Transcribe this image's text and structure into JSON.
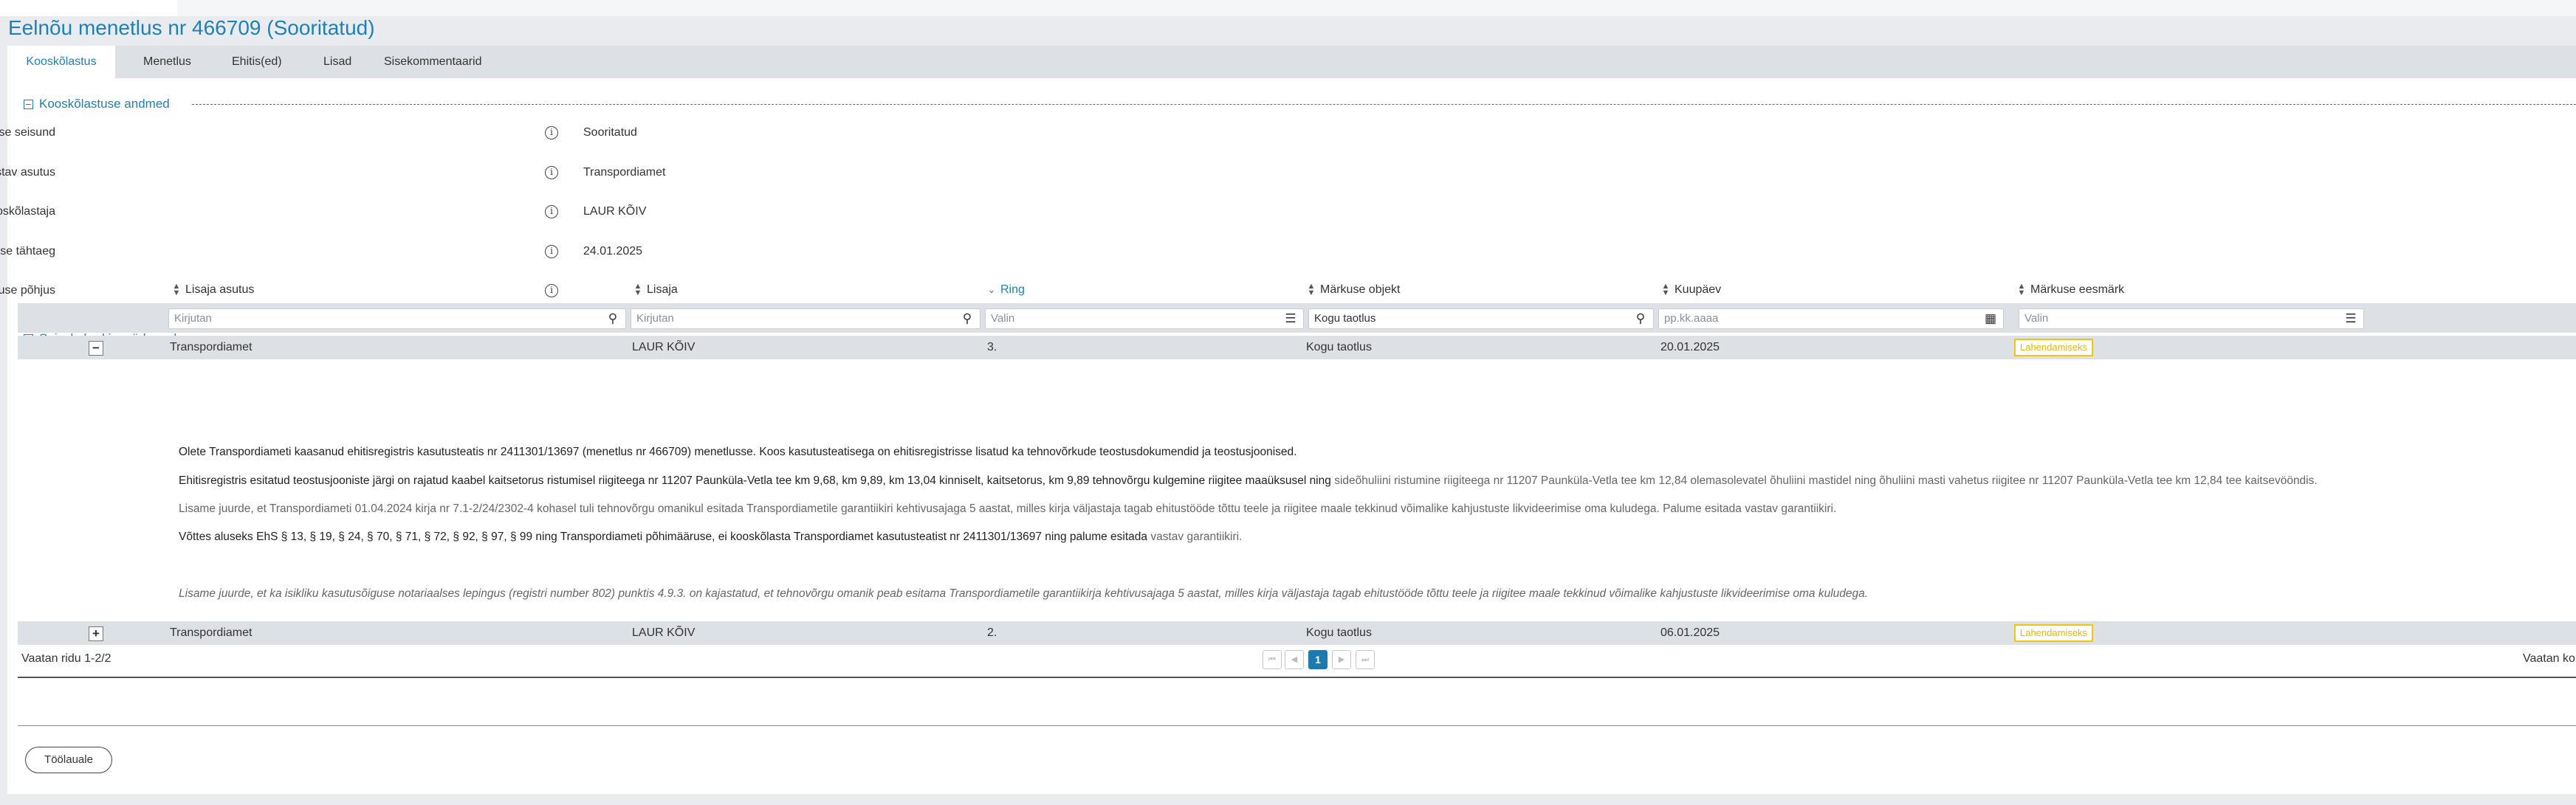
{
  "page_title": "Eelnõu menetlus nr 466709 (Sooritatud)",
  "tabs": [
    {
      "label": "Kooskõlastus",
      "active": true
    },
    {
      "label": "Menetlus"
    },
    {
      "label": "Ehitis(ed)"
    },
    {
      "label": "Lisad"
    },
    {
      "label": "Sisekommentaarid"
    }
  ],
  "section1": {
    "title": "Kooskõlastuse andmed",
    "fields": [
      {
        "label": "Kooskõlastuse seisund",
        "value": "Sooritatud"
      },
      {
        "label": "Kooskõlastav asutus",
        "value": "Transpordiamet"
      },
      {
        "label": "Kooskõlastaja",
        "value": "LAUR KÕIV"
      },
      {
        "label": "Vastamise tähtaeg",
        "value": "24.01.2025"
      },
      {
        "label": "Kooskõlastuse põhjus",
        "value": ""
      }
    ]
  },
  "section2": {
    "title": "Seisukohad ja märkused",
    "columns": [
      "Lisaja asutus",
      "Lisaja",
      "Ring",
      "Märkuse objekt",
      "Kuupäev",
      "Märkuse eesmärk"
    ],
    "filters": {
      "lisaja_asutus": "Kirjutan",
      "lisaja": "Kirjutan",
      "ring": "Valin",
      "objekt": "Kogu taotlus",
      "kuupaev": "pp.kk.aaaa",
      "eesmark": "Valin"
    },
    "rows": [
      {
        "expander": "−",
        "asutus": "Transpordiamet",
        "lisaja": "LAUR KÕIV",
        "ring": "3.",
        "objekt": "Kogu taotlus",
        "kuupaev": "20.01.2025",
        "eesmark": "Lahendamiseks"
      },
      {
        "expander": "+",
        "asutus": "Transpordiamet",
        "lisaja": "LAUR KÕIV",
        "ring": "2.",
        "objekt": "Kogu taotlus",
        "kuupaev": "06.01.2025",
        "eesmark": "Lahendamiseks"
      }
    ],
    "detail": {
      "p1": "Olete Transpordiameti kaasanud ehitisregistris kasutusteatis nr 2411301/13697 (menetlus nr 466709) menetlusse. Koos kasutusteatisega on ehitisregistrisse lisatud ka tehnovõrkude teostusdokumendid ja teostusjoonised.",
      "p2a": "Ehitisregistris esitatud teostusjooniste järgi on rajatud kaabel kaitsetorus ristumisel riigiteega nr 11207 Paunküla-Vetla tee km 9,68, km 9,89, km 13,04 kinniselt, kaitsetorus, km 9,89 tehnovõrgu kulgemine riigitee maaüksusel ning",
      "p2b": "sideõhuliini ristumine riigiteega nr 11207 Paunküla-Vetla tee km 12,84 olemasolevatel õhuliini mastidel ning õhuliini masti vahetus riigitee nr 11207 Paunküla-Vetla tee km 12,84 tee kaitsevööndis.",
      "p3": "Lisame juurde, et Transpordiameti 01.04.2024 kirja nr 7.1-2/24/2302-4 kohasel tuli tehnovõrgu omanikul esitada Transpordiametile garantiikiri kehtivusajaga 5 aastat, milles kirja väljastaja tagab ehitustööde tõttu teele ja riigitee maale tekkinud võimalike kahjustuste likvideerimise oma kuludega. Palume esitada vastav garantiikiri.",
      "p4a": "Võttes aluseks EhS § 13, § 19, § 24, § 70, § 71, § 72, § 92, § 97, § 99 ning Transpordiameti põhimääruse, ei kooskõlasta Transpordiamet kasutusteatist nr 2411301/13697 ning palume esitada",
      "p4b": "vastav garantiikiri.",
      "p5": "Lisame juurde, et ka isikliku kasutusõiguse notariaalses lepingus (registri number 802) punktis 4.9.3. on kajastatud, et tehnovõrgu omanik peab esitama Transpordiametile garantiikirja kehtivusajaga 5 aastat, milles kirja väljastaja tagab ehitustööde tõttu teele ja riigitee maale tekkinud võimalike kahjustuste likvideerimise oma kuludega."
    },
    "pager": {
      "summary": "Vaatan ridu 1-2/2",
      "current_page": "1",
      "right_text": "Vaatan ko"
    }
  },
  "back_button": "Töölauale",
  "colors": {
    "accent": "#1b82b8",
    "badge": "#f1c40f",
    "active_page": "#1b7bb1"
  },
  "icons": [
    "info-icon",
    "search-icon",
    "list-icon",
    "calendar-icon",
    "sort-icon",
    "sort-desc-icon",
    "collapse-icon",
    "expand-icon"
  ]
}
